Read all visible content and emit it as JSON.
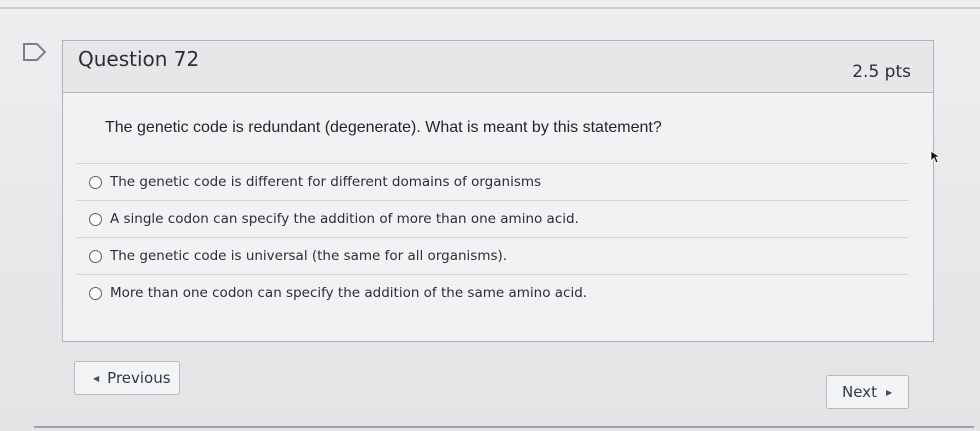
{
  "question": {
    "title": "Question 72",
    "points": "2.5 pts",
    "text": "The genetic code is redundant (degenerate). What is meant by this statement?"
  },
  "answers": [
    {
      "label": "The genetic code is different for different domains of organisms",
      "selected": false
    },
    {
      "label": "A single codon can specify the addition of more than one amino acid.",
      "selected": false
    },
    {
      "label": "The genetic code is universal (the same for all organisms).",
      "selected": false
    },
    {
      "label": "More than one codon can specify the addition of the same amino acid.",
      "selected": false
    }
  ],
  "nav": {
    "previous_label": "Previous",
    "next_label": "Next",
    "previous_icon": "triangle-left-icon",
    "next_icon": "triangle-right-icon"
  },
  "icons": {
    "flag": "flag-icon",
    "cursor": "mouse-cursor-icon"
  },
  "colors": {
    "text": "#2d3b45",
    "border": "#aeb3b7",
    "header_bg": "#e6e7e8"
  }
}
